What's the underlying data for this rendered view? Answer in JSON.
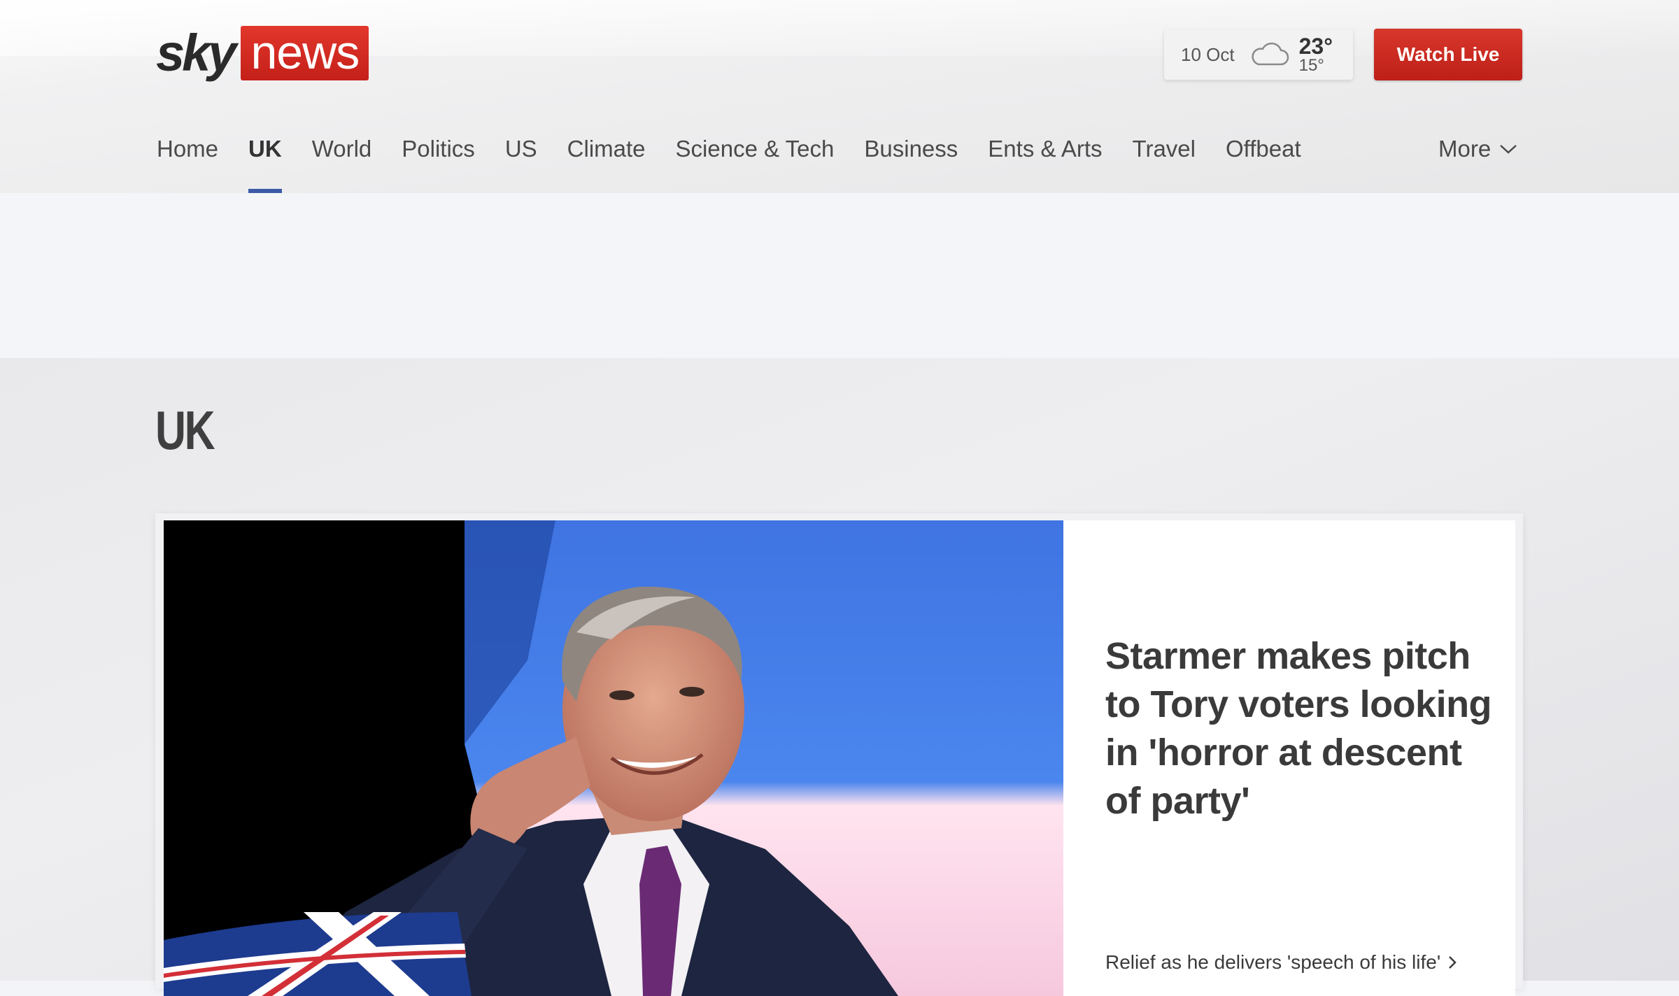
{
  "brand": {
    "logo_sky": "sky",
    "logo_news": "news",
    "accent_red": "#c8251c",
    "accent_blue": "#3c5aa8"
  },
  "weather": {
    "date": "10 Oct",
    "icon": "cloud-icon",
    "high": "23°",
    "low": "15°"
  },
  "header": {
    "watch_live_label": "Watch Live"
  },
  "nav": {
    "items": [
      {
        "label": "Home",
        "active": false
      },
      {
        "label": "UK",
        "active": true
      },
      {
        "label": "World",
        "active": false
      },
      {
        "label": "Politics",
        "active": false
      },
      {
        "label": "US",
        "active": false
      },
      {
        "label": "Climate",
        "active": false
      },
      {
        "label": "Science & Tech",
        "active": false
      },
      {
        "label": "Business",
        "active": false
      },
      {
        "label": "Ents & Arts",
        "active": false
      },
      {
        "label": "Travel",
        "active": false
      },
      {
        "label": "Offbeat",
        "active": false
      }
    ],
    "more_label": "More"
  },
  "section": {
    "title": "UK"
  },
  "lead_story": {
    "headline": "Starmer makes pitch to Tory voters looking in 'horror at descent of party'",
    "related_link": "Relief as he delivers 'speech of his life'"
  }
}
